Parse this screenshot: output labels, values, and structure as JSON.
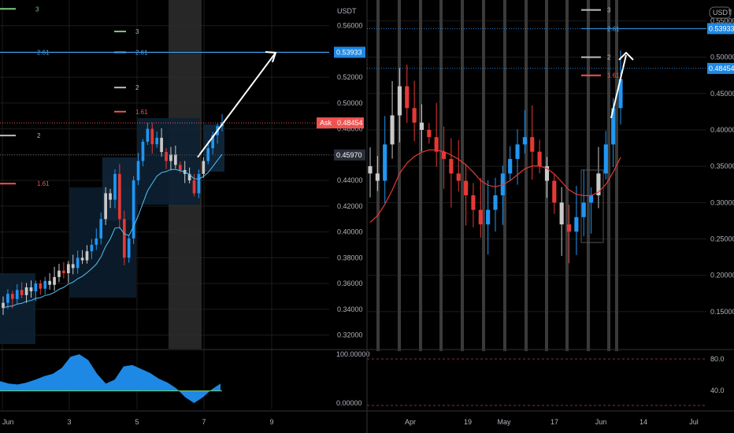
{
  "colors": {
    "bg": "#000000",
    "up": "#2196f3",
    "down": "#e53935",
    "neutral": "#c9c9c9",
    "grid": "#1c1c1c",
    "axis_text": "#b2b5be",
    "fib_1_61": "#ef5350",
    "fib_2": "#bdbdbd",
    "fib_2_61": "#42a5f5",
    "fib_3": "#81c784",
    "ma_left": "#4fc3f7",
    "ma_right": "#e53935",
    "arrow": "#ffffff",
    "osc_fill": "#1e88e5",
    "ask_bg": "#ef5350",
    "price_tag_bg": "#1e88e5",
    "dark_tag_bg": "#2a2e39"
  },
  "chart_data": [
    {
      "type": "candlestick",
      "name_in_image": "left",
      "currency": "USDT",
      "x_labels": [
        "Jun",
        "3",
        "5",
        "7",
        "9"
      ],
      "ylim": [
        0.31,
        0.575
      ],
      "y_ticks": [
        "0.56000",
        "0.54000",
        "0.52000",
        "0.50000",
        "0.48000",
        "0.46000",
        "0.44000",
        "0.42000",
        "0.40000",
        "0.38000",
        "0.36000",
        "0.34000",
        "0.32000"
      ],
      "fib_levels": [
        {
          "label": "3",
          "value": 0.573
        },
        {
          "label": "3",
          "value": 0.5555
        },
        {
          "label": "2.61",
          "value": 0.5393
        },
        {
          "label": "2.61",
          "value": 0.5393
        },
        {
          "label": "2",
          "value": 0.512
        },
        {
          "label": "1.61",
          "value": 0.4933
        },
        {
          "label": "2",
          "value": 0.4748
        },
        {
          "label": "1.61",
          "value": 0.4375
        }
      ],
      "price_tags": [
        {
          "label": "0.53933",
          "value": 0.53933,
          "style": "blue"
        },
        {
          "label": "0.48454",
          "value": 0.48454,
          "style": "ask",
          "prefix": "Ask"
        },
        {
          "label": "0.45970",
          "value": 0.4597,
          "style": "dark"
        }
      ],
      "projection_arrow": {
        "from": [
          0.738,
          0.458
        ],
        "to": [
          0.84,
          0.539
        ]
      },
      "closes": [
        0.345,
        0.352,
        0.348,
        0.355,
        0.351,
        0.357,
        0.354,
        0.36,
        0.356,
        0.362,
        0.359,
        0.365,
        0.37,
        0.368,
        0.375,
        0.372,
        0.38,
        0.378,
        0.385,
        0.39,
        0.395,
        0.41,
        0.43,
        0.425,
        0.445,
        0.41,
        0.38,
        0.395,
        0.44,
        0.455,
        0.47,
        0.48,
        0.468,
        0.473,
        0.462,
        0.455,
        0.46,
        0.452,
        0.448,
        0.445,
        0.44,
        0.43,
        0.445,
        0.455,
        0.465,
        0.475,
        0.482,
        0.485
      ],
      "indicator": {
        "upper_label": "100.00000",
        "lower_label": "0.00000"
      }
    },
    {
      "type": "candlestick",
      "name_in_image": "right",
      "currency": "USDT",
      "x_labels": [
        "Apr",
        "19",
        "May",
        "17",
        "Jun",
        "14",
        "Jul"
      ],
      "ylim": [
        0.1,
        0.57
      ],
      "y_ticks": [
        "0.55000",
        "0.50000",
        "0.45000",
        "0.40000",
        "0.35000",
        "0.30000",
        "0.25000",
        "0.20000",
        "0.15000"
      ],
      "fib_levels": [
        {
          "label": "3",
          "value": 0.565
        },
        {
          "label": "2.61",
          "value": 0.5393
        },
        {
          "label": "2",
          "value": 0.5
        },
        {
          "label": "1.61",
          "value": 0.475
        }
      ],
      "price_tags": [
        {
          "label": "0.53933",
          "value": 0.53933,
          "style": "blue"
        },
        {
          "label": "0.48454",
          "value": 0.48454,
          "style": "blue"
        }
      ],
      "closes": [
        0.34,
        0.33,
        0.38,
        0.42,
        0.46,
        0.43,
        0.41,
        0.4,
        0.39,
        0.37,
        0.36,
        0.34,
        0.33,
        0.31,
        0.29,
        0.27,
        0.29,
        0.31,
        0.34,
        0.36,
        0.38,
        0.39,
        0.37,
        0.35,
        0.33,
        0.3,
        0.27,
        0.26,
        0.28,
        0.3,
        0.31,
        0.34,
        0.38,
        0.43,
        0.47
      ],
      "rsi": {
        "labels": [
          "80.0",
          "40.0"
        ]
      }
    }
  ]
}
